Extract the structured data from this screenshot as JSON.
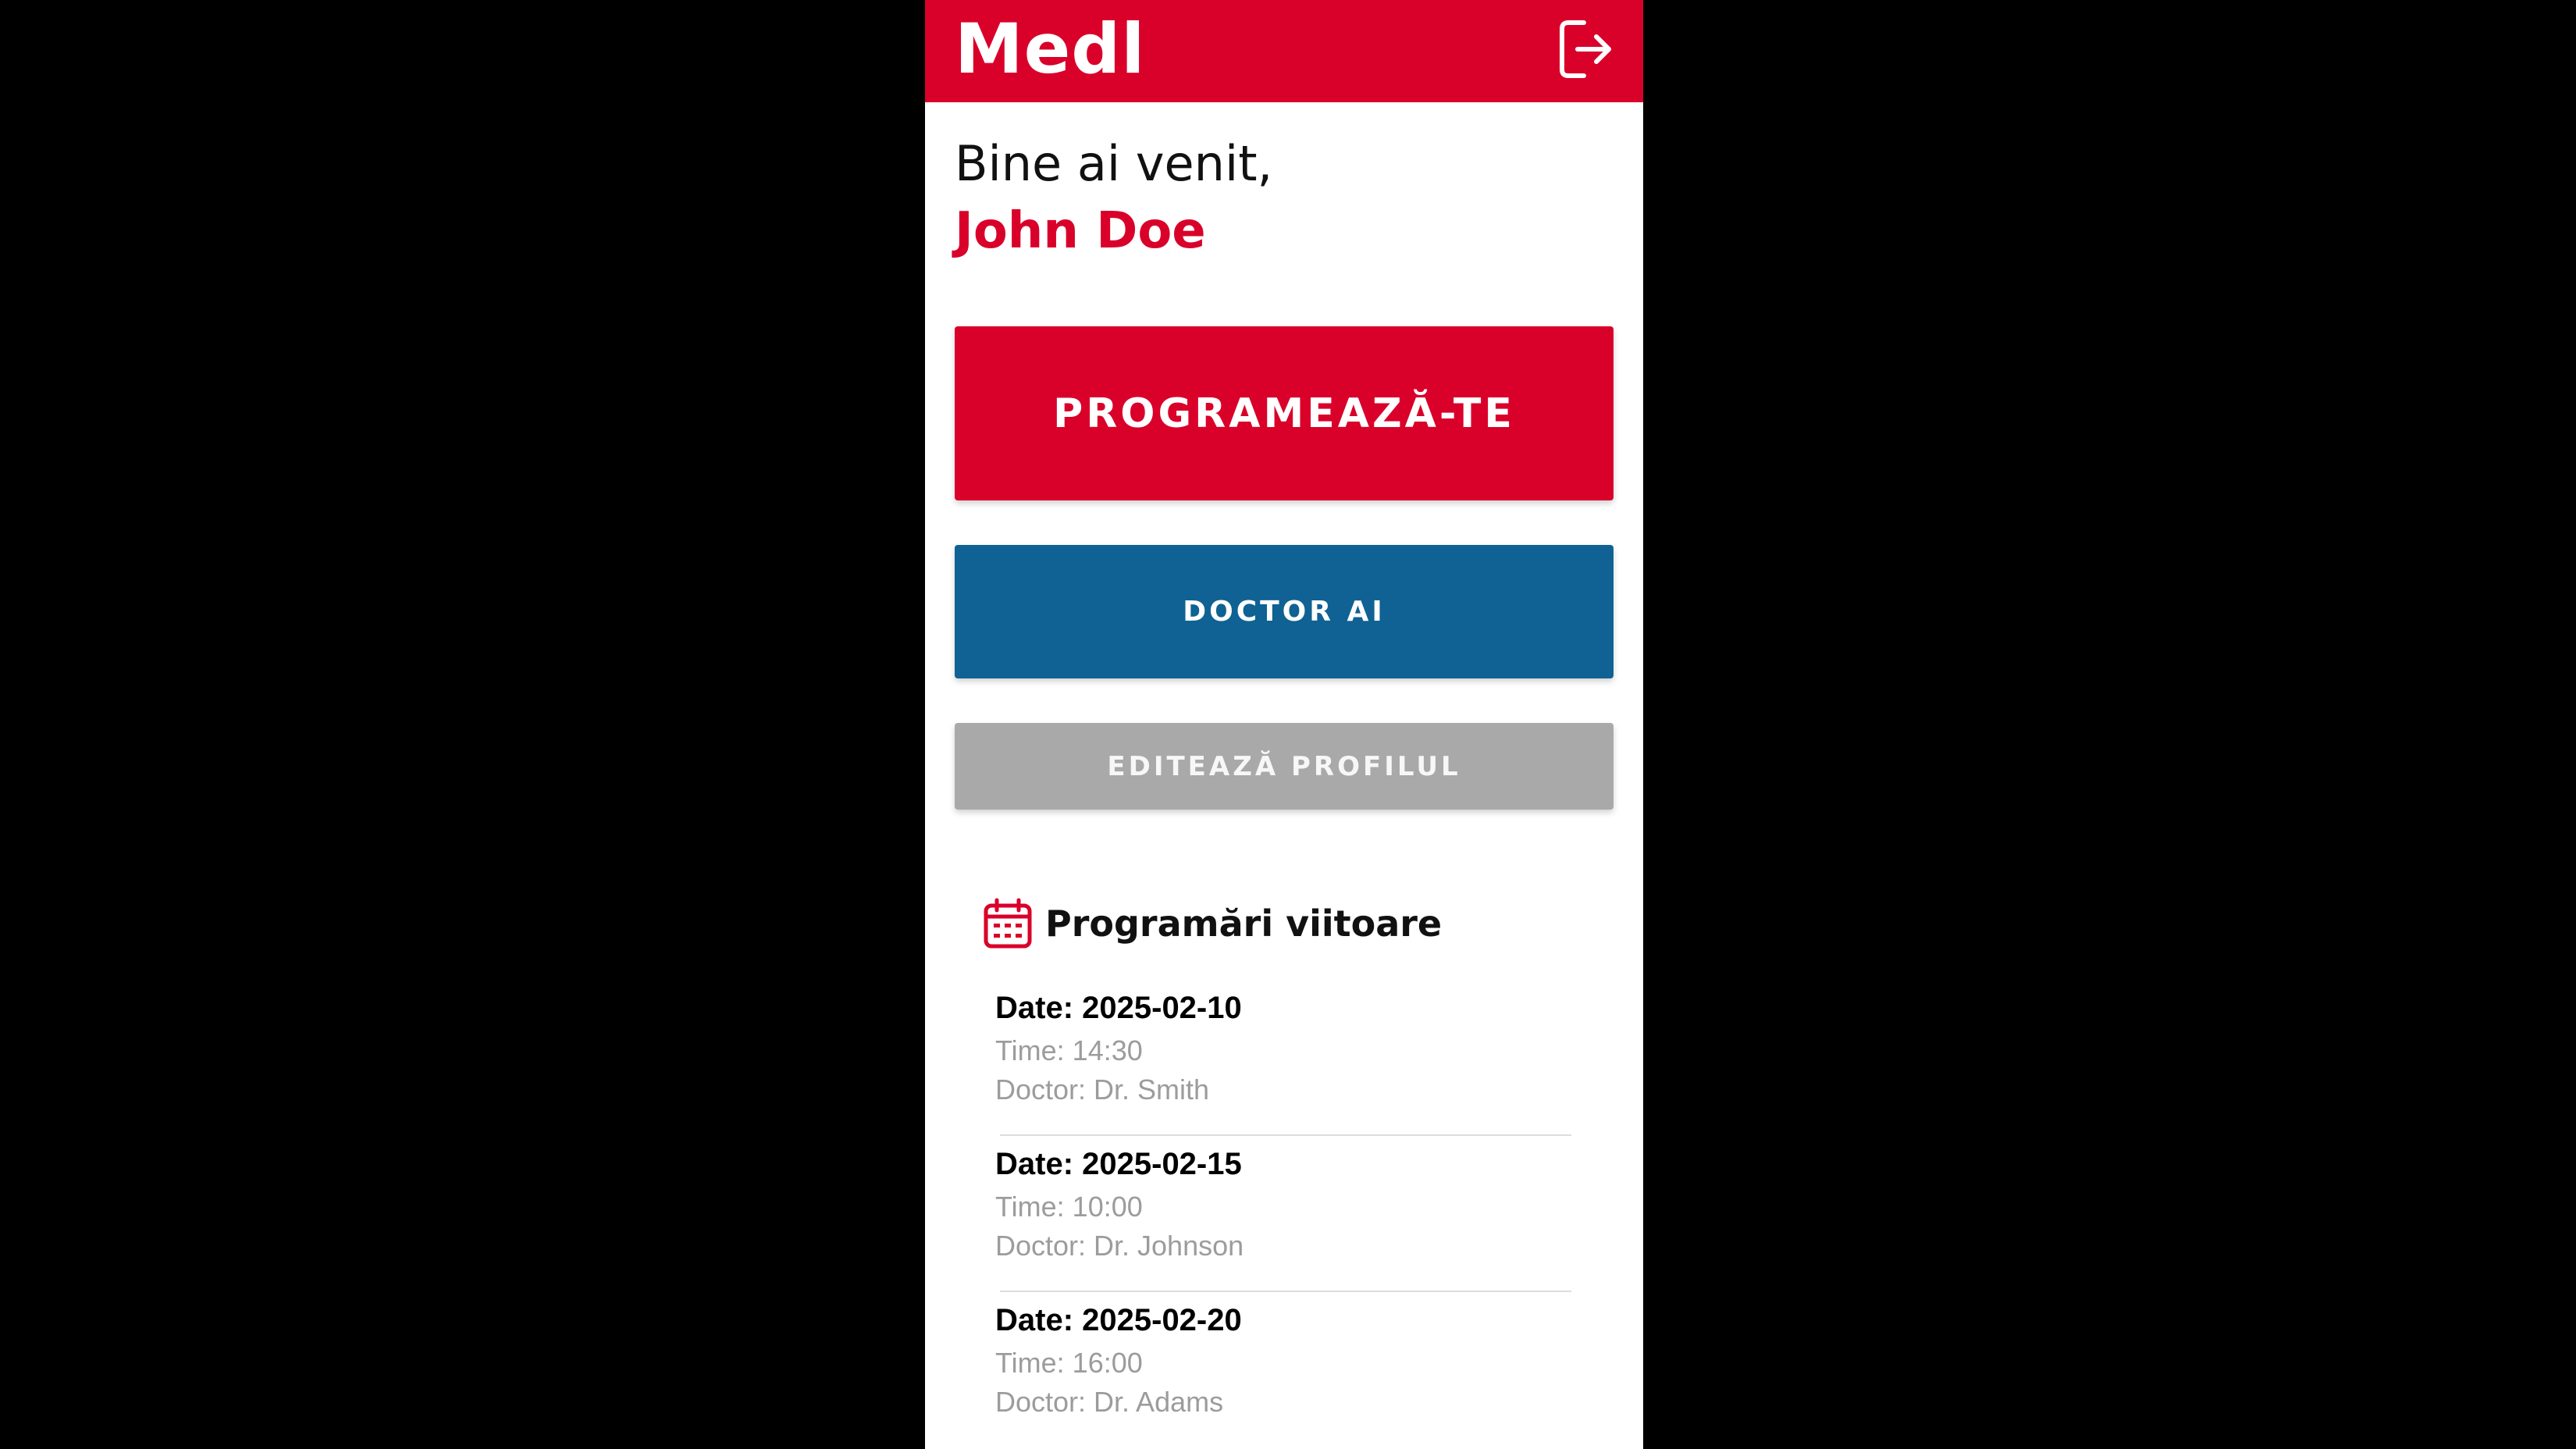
{
  "header": {
    "title": "Medl",
    "logout_icon": "logout-icon"
  },
  "welcome": {
    "greeting": "Bine ai venit,",
    "user_name": "John Doe"
  },
  "actions": {
    "book_label": "PROGRAMEAZĂ-TE",
    "ai_label": "DOCTOR AI",
    "edit_label": "EDITEAZĂ PROFILUL"
  },
  "upcoming": {
    "icon": "calendar-icon",
    "title": "Programări viitoare",
    "items": [
      {
        "date": "Date: 2025-02-10",
        "time": "Time: 14:30",
        "doctor": "Doctor: Dr. Smith"
      },
      {
        "date": "Date: 2025-02-15",
        "time": "Time: 10:00",
        "doctor": "Doctor: Dr. Johnson"
      },
      {
        "date": "Date: 2025-02-20",
        "time": "Time: 16:00",
        "doctor": "Doctor: Dr. Adams"
      }
    ]
  },
  "colors": {
    "brand_red": "#d9002a",
    "ai_blue": "#0f6293",
    "edit_gray": "#a9a9a9",
    "muted_text": "#9c9c9c"
  }
}
